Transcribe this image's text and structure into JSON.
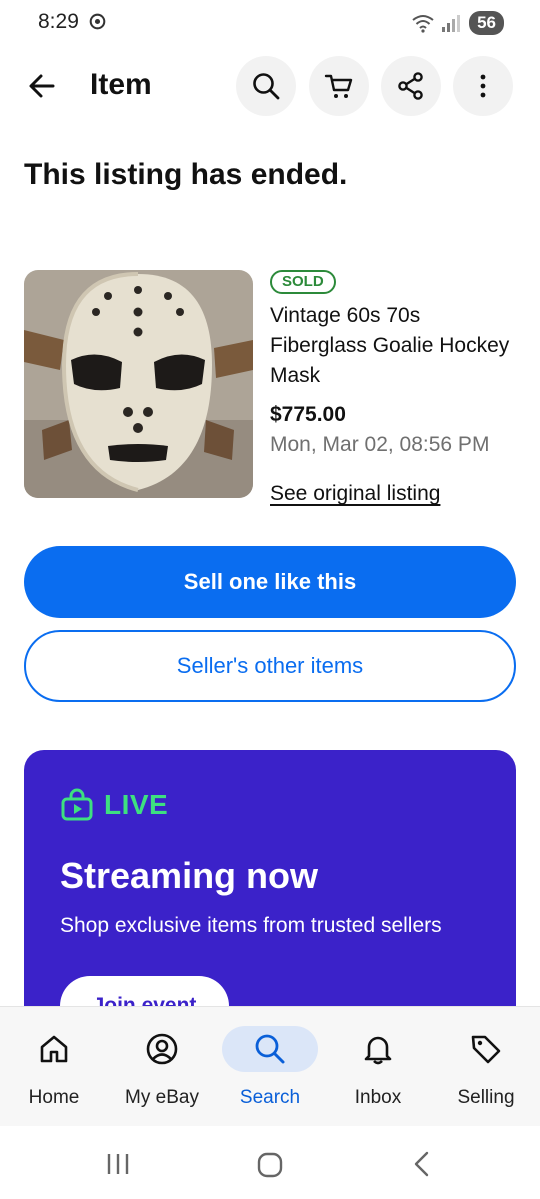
{
  "status_bar": {
    "time": "8:29",
    "battery": "56"
  },
  "app_bar": {
    "title": "Item"
  },
  "listing": {
    "ended_message": "This listing has ended.",
    "sold_badge": "SOLD",
    "title": "Vintage 60s 70s Fiberglass Goalie Hockey Mask",
    "price": "$775.00",
    "date": "Mon, Mar 02, 08:56 PM",
    "see_original": "See original listing"
  },
  "actions": {
    "sell_label": "Sell one like this",
    "seller_items_label": "Seller's other items"
  },
  "live_card": {
    "badge": "LIVE",
    "heading": "Streaming now",
    "subtext": "Shop exclusive items from trusted sellers",
    "join_label": "Join event"
  },
  "bottom_nav": {
    "items": [
      {
        "label": "Home",
        "icon": "home-icon"
      },
      {
        "label": "My eBay",
        "icon": "account-icon"
      },
      {
        "label": "Search",
        "icon": "search-icon"
      },
      {
        "label": "Inbox",
        "icon": "bell-icon"
      },
      {
        "label": "Selling",
        "icon": "tag-icon"
      }
    ],
    "active": "Search"
  },
  "colors": {
    "accent": "#0a6df0",
    "live_card_bg": "#3b22c9",
    "live_green": "#3ee080",
    "sold_green": "#2c8a3a"
  }
}
